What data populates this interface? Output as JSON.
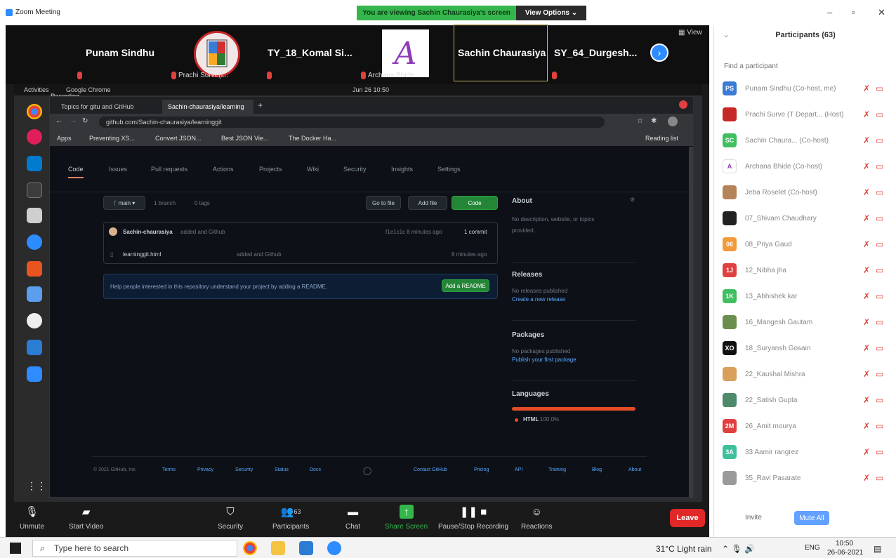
{
  "window": {
    "title": "Zoom Meeting"
  },
  "banner": {
    "viewing": "You are viewing Sachin Chaurasiya's screen",
    "view_options": "View Options ⌄"
  },
  "gallery": {
    "tiles": [
      {
        "name": "Punam Sindhu",
        "sub": ""
      },
      {
        "name": "",
        "sub": "Prachi Surve(I..."
      },
      {
        "name": "TY_18_Komal Si...",
        "sub": ""
      },
      {
        "name": "",
        "sub": "Archana Bhide"
      },
      {
        "name": "Sachin Chaurasiya",
        "sub": ""
      },
      {
        "name": "SY_64_Durgesh...",
        "sub": ""
      }
    ],
    "view_label": "View"
  },
  "ubuntu": {
    "recording": "Recording...",
    "clock": "Jun 26  10:50",
    "activities": "Activities",
    "app": "Google Chrome"
  },
  "chrome": {
    "tabs": [
      "Topics for gitu and GitHub",
      "Sachin-chaurasiya/learning"
    ],
    "url": "github.com/Sachin-chaurasiya/learninggit",
    "bookmarks": [
      "Apps",
      "Preventing XS...",
      "Convert JSON...",
      "Best JSON Vie...",
      "The Docker Ha..."
    ],
    "reading_list": "Reading list"
  },
  "github": {
    "nav": [
      "Code",
      "Issues",
      "Pull requests",
      "Actions",
      "Projects",
      "Wiki",
      "Security",
      "Insights",
      "Settings"
    ],
    "branch": "main",
    "branches": "1 branch",
    "tags": "0 tags",
    "go_to_file": "Go to file",
    "add_file": "Add file",
    "code_btn": "Code",
    "commit_author": "Sachin-chaurasiya",
    "commit_msg": "added and Github",
    "commit_meta": "f1e1c1c  8 minutes ago",
    "commits": "1 commit",
    "file_name": "learninggit.html",
    "file_msg": "added and Github",
    "file_time": "8 minutes ago",
    "readme_msg": "Help people interested in this repository understand your project by adding a README.",
    "readme_btn": "Add a README",
    "about_title": "About",
    "about_text1": "No description, website, or topics",
    "about_text2": "provided.",
    "releases_title": "Releases",
    "releases_text": "No releases published",
    "releases_link": "Create a new release",
    "packages_title": "Packages",
    "packages_text": "No packages published",
    "packages_link": "Publish your first package",
    "languages_title": "Languages",
    "lang": "HTML",
    "lang_pct": "100.0%",
    "lang_color": "#e34c26",
    "footer": [
      "© 2021 GitHub, Inc.",
      "Terms",
      "Privacy",
      "Security",
      "Status",
      "Docs",
      "Contact GitHub",
      "Pricing",
      "API",
      "Training",
      "Blog",
      "About"
    ]
  },
  "toolbar": {
    "unmute": "Unmute",
    "start_video": "Start Video",
    "security": "Security",
    "participants": "Participants",
    "participants_count": "63",
    "chat": "Chat",
    "share_screen": "Share Screen",
    "recording": "Pause/Stop Recording",
    "reactions": "Reactions",
    "leave": "Leave"
  },
  "participants_panel": {
    "title": "Participants (63)",
    "search_placeholder": "Find a participant",
    "invite": "Invite",
    "mute_all": "Mute All",
    "list": [
      {
        "initials": "PS",
        "color": "#3a7bd5",
        "name": "Punam Sindhu (Co-host, me)"
      },
      {
        "initials": "",
        "color": "#c62828",
        "name": "Prachi Surve (T Depart... (Host)"
      },
      {
        "initials": "SC",
        "color": "#3fbf5f",
        "name": "Sachin Chaura... (Co-host)"
      },
      {
        "initials": "A",
        "color": "#ffffff",
        "name": "Archana Bhide (Co-host)"
      },
      {
        "initials": "",
        "color": "#b5835a",
        "name": "Jeba Roselet (Co-host)"
      },
      {
        "initials": "",
        "color": "#222222",
        "name": "07_Shivam Chaudhary"
      },
      {
        "initials": "06",
        "color": "#f29a3a",
        "name": "08_Priya Gaud"
      },
      {
        "initials": "1J",
        "color": "#e04040",
        "name": "12_Nibha jha"
      },
      {
        "initials": "1K",
        "color": "#3fbf5f",
        "name": "13_Abhishek kar"
      },
      {
        "initials": "",
        "color": "#6b8e4e",
        "name": "16_Mangesh Gautam"
      },
      {
        "initials": "XO",
        "color": "#111111",
        "name": "18_Suryansh Gosain"
      },
      {
        "initials": "",
        "color": "#d9a05b",
        "name": "22_Kaushal Mishra"
      },
      {
        "initials": "",
        "color": "#4e8a6b",
        "name": "22_Satish Gupta"
      },
      {
        "initials": "2M",
        "color": "#e04040",
        "name": "26_Amit mourya"
      },
      {
        "initials": "3A",
        "color": "#3fbf9f",
        "name": "33 Aamir rangrez"
      },
      {
        "initials": "",
        "color": "#9a9a9a",
        "name": "35_Ravi Pasarate"
      }
    ]
  },
  "taskbar": {
    "search_placeholder": "Type here to search",
    "weather": "31°C  Light rain",
    "lang": "ENG",
    "time": "10:50",
    "date": "26-06-2021"
  }
}
